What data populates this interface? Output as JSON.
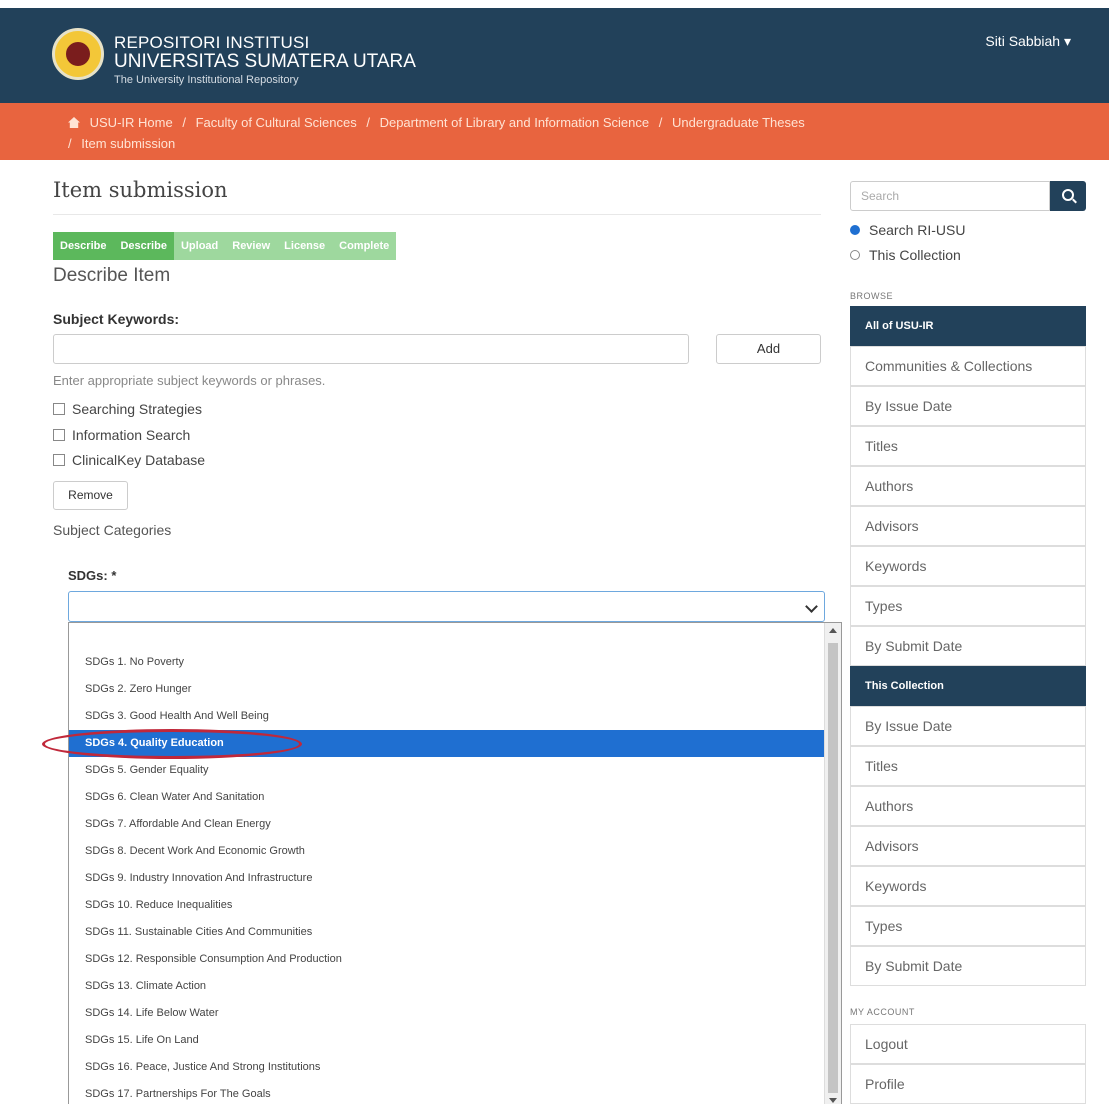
{
  "header": {
    "title_line1": "REPOSITORI INSTITUSI",
    "title_line2": "UNIVERSITAS SUMATERA UTARA",
    "title_line3": "The University Institutional Repository",
    "user": "Siti Sabbiah",
    "user_caret": "▾"
  },
  "breadcrumb": {
    "items": [
      "USU-IR Home",
      "Faculty of Cultural Sciences",
      "Department of Library and Information Science",
      "Undergraduate Theses",
      "Item submission"
    ],
    "separator": "/"
  },
  "page": {
    "title": "Item submission",
    "progress": [
      "Describe",
      "Describe",
      "Upload",
      "Review",
      "License",
      "Complete"
    ],
    "section": "Describe Item"
  },
  "form": {
    "keywords_label": "Subject Keywords:",
    "add_label": "Add",
    "help": "Enter appropriate subject keywords or phrases.",
    "keywords": [
      "Searching Strategies",
      "Information Search",
      "ClinicalKey Database"
    ],
    "remove_label": "Remove",
    "subject_categories": "Subject Categories",
    "sdgs_label": "SDGs: *",
    "sdgs_value": "",
    "sdgs_options": [
      "SDGs 1. No Poverty",
      "SDGs 2. Zero Hunger",
      "SDGs 3. Good Health And Well Being",
      "SDGs 4. Quality Education",
      "SDGs 5. Gender Equality",
      "SDGs 6. Clean Water And Sanitation",
      "SDGs 7. Affordable And Clean Energy",
      "SDGs 8. Decent Work And Economic Growth",
      "SDGs 9. Industry Innovation And Infrastructure",
      "SDGs 10. Reduce Inequalities",
      "SDGs 11. Sustainable Cities And Communities",
      "SDGs 12. Responsible Consumption And Production",
      "SDGs 13. Climate Action",
      "SDGs 14. Life Below Water",
      "SDGs 15. Life On Land",
      "SDGs 16. Peace, Justice And Strong Institutions",
      "SDGs 17. Partnerships For The Goals"
    ],
    "selected_option": "SDGs 4. Quality Education"
  },
  "sidebar": {
    "search_placeholder": "Search",
    "scope_options": [
      "Search RI-USU",
      "This Collection"
    ],
    "browse_heading": "BROWSE",
    "all_heading": "All of USU-IR",
    "all_items": [
      "Communities & Collections",
      "By Issue Date",
      "Titles",
      "Authors",
      "Advisors",
      "Keywords",
      "Types",
      "By Submit Date"
    ],
    "collection_heading": "This Collection",
    "collection_items": [
      "By Issue Date",
      "Titles",
      "Authors",
      "Advisors",
      "Keywords",
      "Types",
      "By Submit Date"
    ],
    "account_heading": "MY ACCOUNT",
    "account_items": [
      "Logout",
      "Profile"
    ]
  },
  "colors": {
    "header_bg": "#22415a",
    "breadcrumb_bg": "#e8643f",
    "progress_done": "#5cb85c",
    "selected_option": "#1f6fd1",
    "annotation_circle": "#c0283a"
  }
}
